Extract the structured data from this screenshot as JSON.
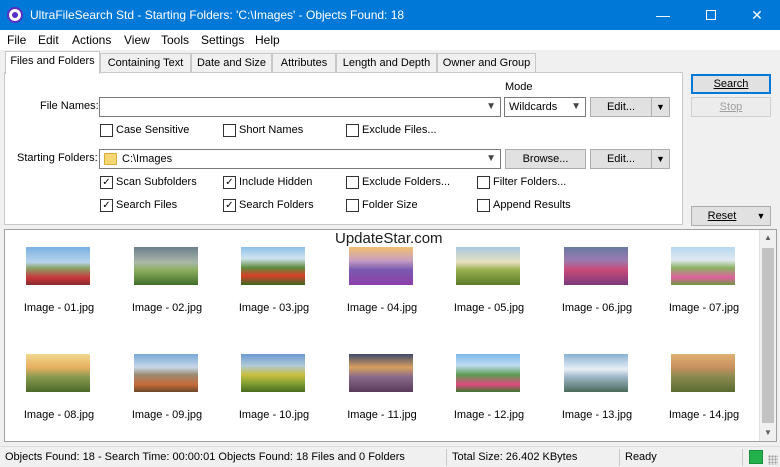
{
  "window": {
    "title": "UltraFileSearch Std - Starting Folders: 'C:\\Images' - Objects Found: 18",
    "minimize": "—",
    "close": "✕"
  },
  "menu": [
    "File",
    "Edit",
    "Actions",
    "View",
    "Tools",
    "Settings",
    "Help"
  ],
  "tabs": [
    "Files and Folders",
    "Containing Text",
    "Date and Size",
    "Attributes",
    "Length and Depth",
    "Owner and Group"
  ],
  "form": {
    "mode_label": "Mode",
    "file_names_label": "File Names:",
    "file_names_value": "",
    "mode_value": "Wildcards",
    "edit_label": "Edit...",
    "starting_folders_label": "Starting Folders:",
    "starting_folder_value": "C:\\Images",
    "browse_label": "Browse...",
    "checkboxes_row1": [
      {
        "label": "Case Sensitive",
        "checked": false
      },
      {
        "label": "Short Names",
        "checked": false
      },
      {
        "label": "Exclude  Files...",
        "checked": false
      }
    ],
    "checkboxes_row2": [
      {
        "label": "Scan Subfolders",
        "checked": true
      },
      {
        "label": "Include Hidden",
        "checked": true
      },
      {
        "label": "Exclude  Folders...",
        "checked": false
      },
      {
        "label": "Filter Folders...",
        "checked": false
      }
    ],
    "checkboxes_row3": [
      {
        "label": "Search Files",
        "checked": true
      },
      {
        "label": "Search Folders",
        "checked": true
      },
      {
        "label": "Folder Size",
        "checked": false
      },
      {
        "label": "Append Results",
        "checked": false
      }
    ]
  },
  "actions": {
    "search": "Search",
    "stop": "Stop",
    "reset": "Reset"
  },
  "watermark": "UpdateStar.com",
  "results": [
    "Image - 01.jpg",
    "Image - 02.jpg",
    "Image - 03.jpg",
    "Image - 04.jpg",
    "Image - 05.jpg",
    "Image - 06.jpg",
    "Image - 07.jpg",
    "Image - 08.jpg",
    "Image - 09.jpg",
    "Image - 10.jpg",
    "Image - 11.jpg",
    "Image - 12.jpg",
    "Image - 13.jpg",
    "Image - 14.jpg"
  ],
  "status": {
    "objects": "Objects Found: 18 - Search Time: 00:00:01 Objects Found: 18 Files and 0 Folders",
    "size": "Total Size: 26.402 KBytes",
    "state": "Ready"
  },
  "colors": {
    "titlebar": "#0078d7",
    "ready_indicator": "#22b14c"
  }
}
